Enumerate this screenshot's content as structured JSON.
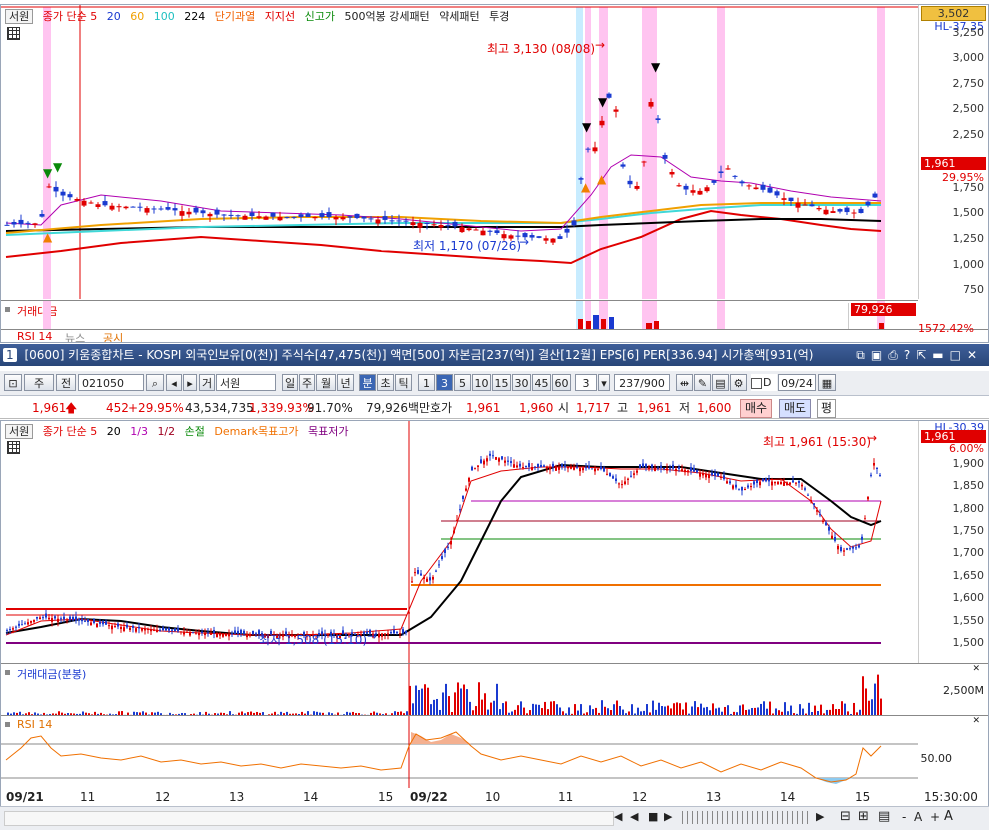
{
  "upper_chart": {
    "legend": [
      "서원",
      "종가 단순 5",
      "20",
      "60",
      "100",
      "224",
      "단기과열",
      "지지선",
      "신고가",
      "500억봉 강세패턴",
      "약세패턴",
      "투경"
    ],
    "current_price_box": "3,502",
    "hl_label": "HL-37.35",
    "y_axis": [
      "3,250",
      "3,000",
      "2,750",
      "2,500",
      "2,250",
      "1,961",
      "29.95%",
      "1,750",
      "1,500",
      "1,250",
      "1,000",
      "750"
    ],
    "max_label": "최고 3,130 (08/08)",
    "min_label": "최저 1,170 (07/26)",
    "volume_label": "거래대금",
    "volume_value": "79,926",
    "volume_pct": "1572.42%",
    "rsi_label": "RSI 14",
    "news_label": "뉴스",
    "notice_label": "공시"
  },
  "window": {
    "number": "1",
    "title": "[0600] 키움종합차트 - KOSPI 외국인보유[0(천)] 주식수[47,475(천)] 액면[500] 자본금[237(억)] 결산[12월] EPS[6] PER[336.94] 시가총액[931(억)]"
  },
  "toolbar": {
    "type1": "주",
    "type2": "전",
    "code": "021050",
    "stock_name": "서원",
    "name_prefix": "거",
    "periods": [
      "일",
      "주",
      "월",
      "년",
      "분",
      "초",
      "틱"
    ],
    "minutes": [
      "1",
      "3",
      "5",
      "10",
      "15",
      "30",
      "45",
      "60"
    ],
    "selected_minute": "3",
    "count_value": "3",
    "range": "237",
    "range_max": "/900",
    "d_label": "D",
    "date": "09/24"
  },
  "quote": {
    "price": "1,961",
    "change": "452",
    "change_pct": "+29.95%",
    "volume": "43,534,735",
    "volume_pct": "1,339.93%",
    "ratio": "91.70%",
    "amount": "79,926백만",
    "bid_label": "호가",
    "bid1": "1,961",
    "bid2": "1,960",
    "open_label": "시",
    "open": "1,717",
    "high_label": "고",
    "high": "1,961",
    "low_label": "저",
    "low": "1,600",
    "buy_label": "매수",
    "sell_label": "매도",
    "eval_label": "평"
  },
  "lower_chart": {
    "legend": [
      "서원",
      "종가 단순 5",
      "20",
      "1/3",
      "1/2",
      "손절",
      "Demark목표고가",
      "목표저가"
    ],
    "hl_label": "HL-30.39",
    "price_box": "1,961",
    "pct_label": "6.00%",
    "y_axis": [
      "1,900",
      "1,850",
      "1,800",
      "1,750",
      "1,700",
      "1,650",
      "1,600",
      "1,550",
      "1,500"
    ],
    "max_label": "최고 1,961 (15:30)",
    "min_label": "최저 1,508 (15:10)",
    "volume_label": "거래대금(분봉)",
    "volume_axis": "2,500M",
    "rsi_label": "RSI 14",
    "rsi_axis": "50.00",
    "x_labels": [
      "09/21",
      "11",
      "12",
      "13",
      "14",
      "15",
      "09/22",
      "10",
      "11",
      "12",
      "13",
      "14",
      "15"
    ],
    "time_label": "15:30:00"
  },
  "colors": {
    "up": "#e00000",
    "down": "#1a3ad0",
    "highlight": "#ffc4f0",
    "ma5": "#b000b0",
    "ma20": "#000000",
    "ma60": "#f0a000",
    "ma100": "#40d8d8",
    "ma224": "#e00000"
  }
}
